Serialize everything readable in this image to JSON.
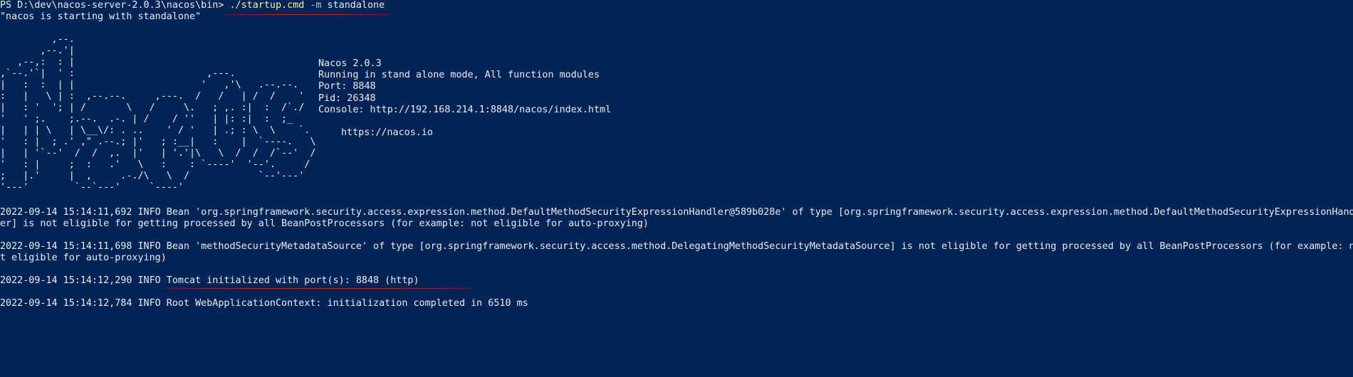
{
  "terminal": {
    "prompt": "PS D:\\dev\\nacos-server-2.0.3\\nacos\\bin>",
    "command": "./startup.cmd",
    "flag": "-m",
    "arg": "standalone",
    "starting_msg": "\"nacos is starting with standalone\""
  },
  "banner": {
    "ascii_art": "         ,--.\n       ,--.'|\n   ,--,:  : |\n,`--.'`|  ' :                       ,---.\n|   :  :  | |                      '   ,'\\   .--.--.\n:   |   \\ | :  ,--.--.     ,---.  /   /   | /  /    '\n|   : '  '; | /       \\   /     \\.   ; ,. :|  :  /`./\n'   ' ;.    ;.--.  .-. | /    / ''   | |: :|  :  ;_\n|   | | \\   | \\__\\/: . ..    ' / '   | .; : \\  \\    `.\n'   : |  ; .' ,\" .--.; |'   ; :__|   :    |  `----.   \\\n|   | '`--'  /  /  ,.  |'   | '.'|\\   \\  /  /  /`--'  /\n'   : |     ;  :   .'   \\   :    : `----'  '--'.     /\n;   |.'     |  ,     .-./\\   \\  /            `--'---'\n'---'        `--`---'     `----'",
    "product": "Nacos 2.0.3",
    "mode": "Running in stand alone mode, All function modules",
    "port": "Port: 8848",
    "pid": "Pid: 26348",
    "console": "Console: http://192.168.214.1:8848/nacos/index.html",
    "site": "https://nacos.io"
  },
  "logs": [
    "2022-09-14 15:14:11,692 INFO Bean 'org.springframework.security.access.expression.method.DefaultMethodSecurityExpressionHandler@589b028e' of type [org.springframework.security.access.expression.method.DefaultMethodSecurityExpressionHandl",
    "er] is not eligible for getting processed by all BeanPostProcessors (for example: not eligible for auto-proxying)",
    "2022-09-14 15:14:11,698 INFO Bean 'methodSecurityMetadataSource' of type [org.springframework.security.access.method.DelegatingMethodSecurityMetadataSource] is not eligible for getting processed by all BeanPostProcessors (for example: no",
    "t eligible for auto-proxying)",
    "2022-09-14 15:14:12,290 INFO Tomcat initialized with port(s): 8848 (http)",
    "2022-09-14 15:14:12,784 INFO Root WebApplicationContext: initialization completed in 6510 ms"
  ],
  "colors": {
    "background": "#012456",
    "text": "#eeedf0",
    "command": "#f9f1a5",
    "annotation": "#d81e1e"
  }
}
